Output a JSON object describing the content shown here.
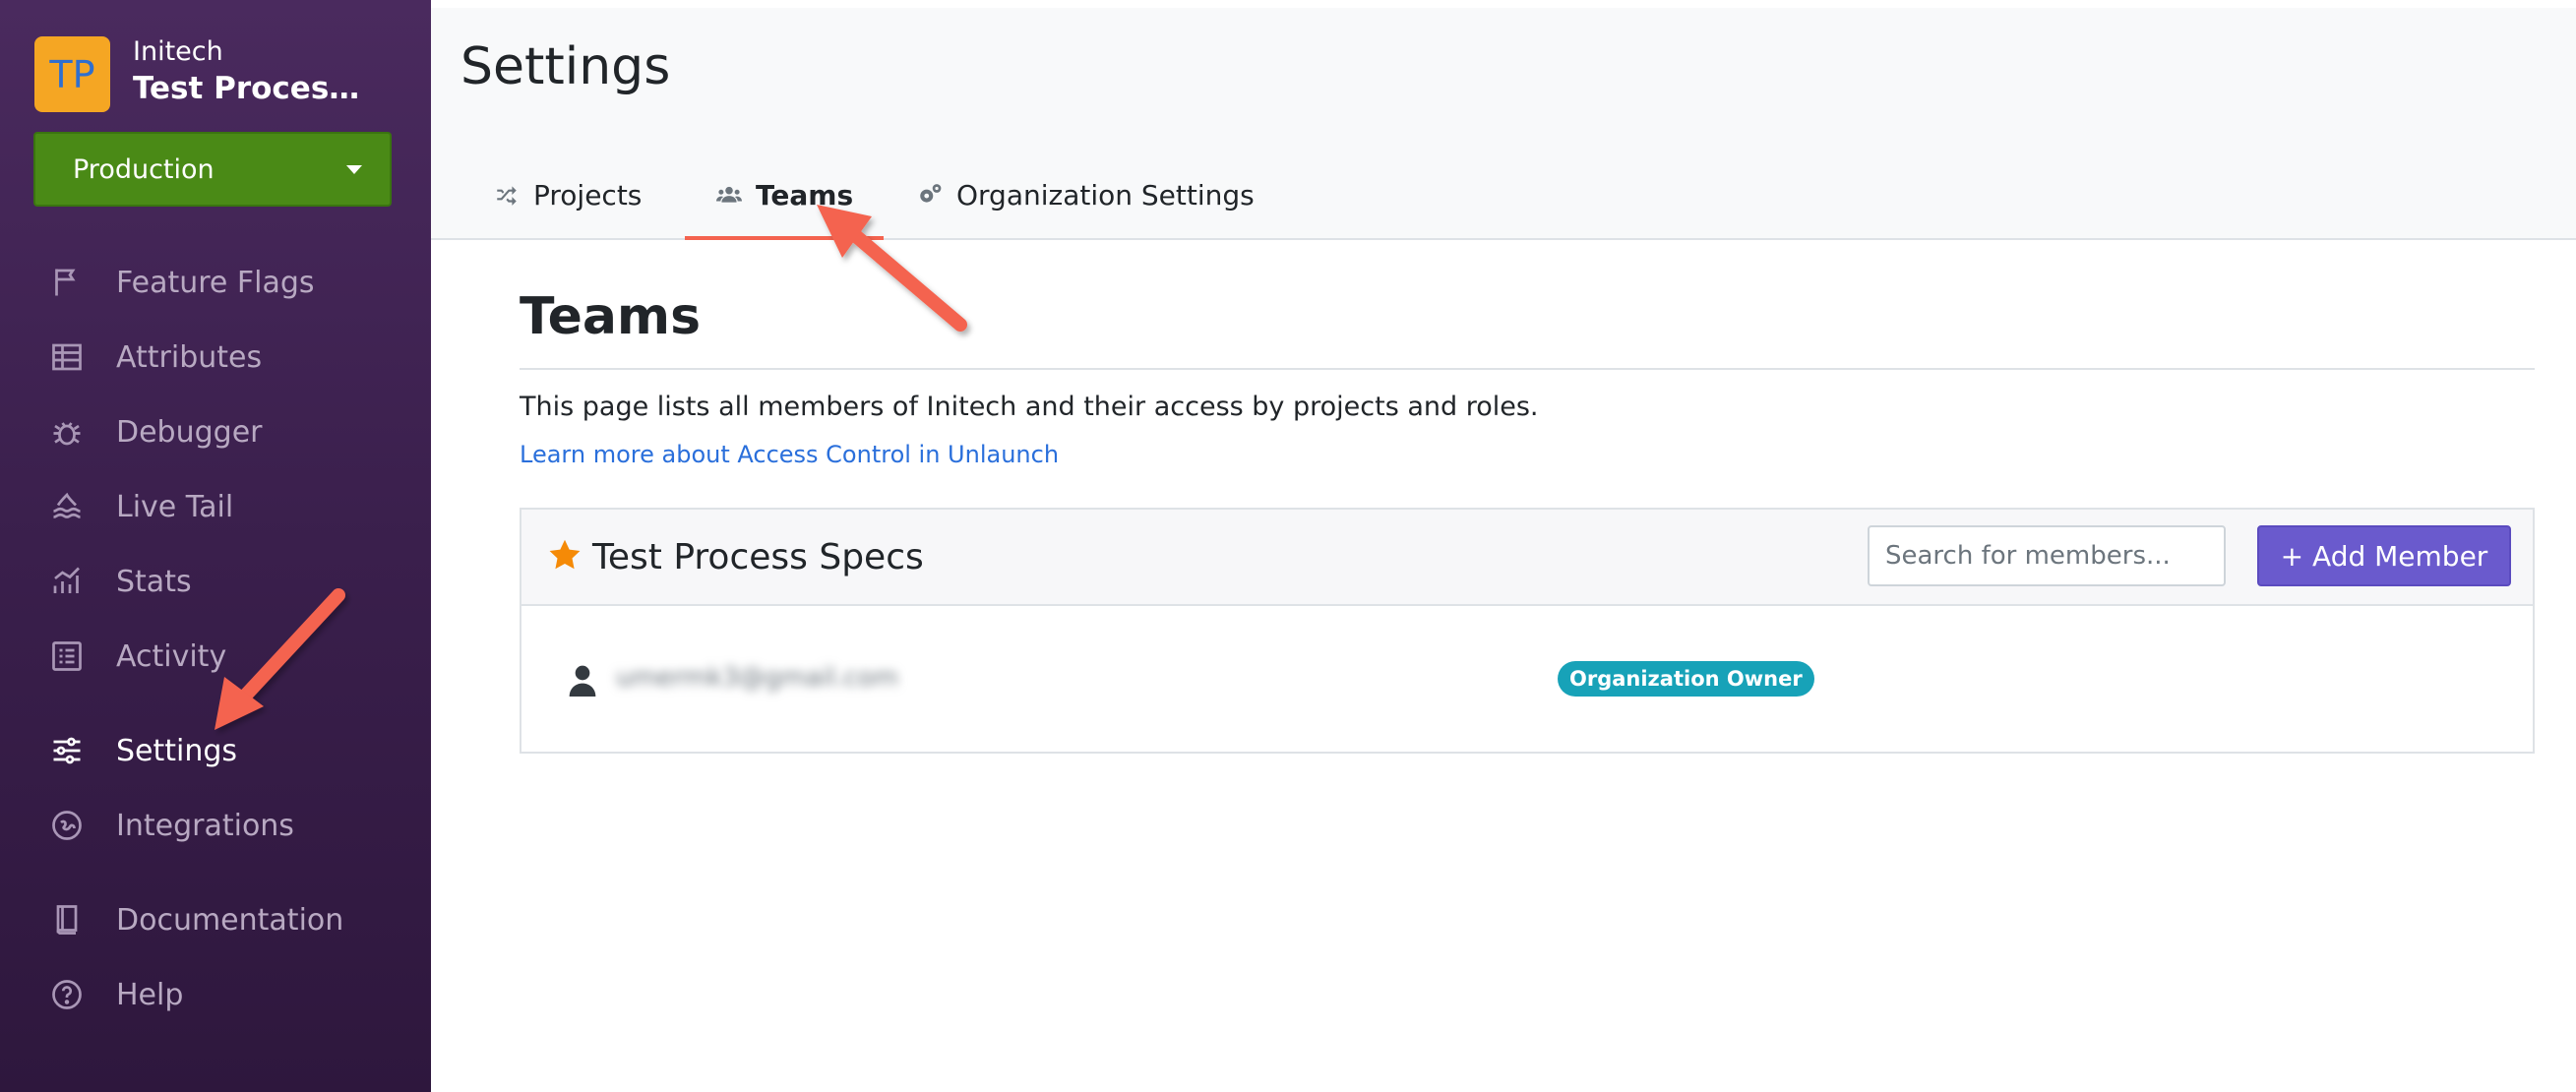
{
  "sidebar": {
    "org_initials": "TP",
    "org_name": "Initech",
    "project_name": "Test Process Specs",
    "environment": "Production",
    "items": [
      {
        "label": "Feature Flags",
        "icon": "flag-icon"
      },
      {
        "label": "Attributes",
        "icon": "attributes-icon"
      },
      {
        "label": "Debugger",
        "icon": "bug-icon"
      },
      {
        "label": "Live Tail",
        "icon": "water-icon"
      },
      {
        "label": "Stats",
        "icon": "chart-icon"
      },
      {
        "label": "Activity",
        "icon": "list-icon"
      },
      {
        "label": "Settings",
        "icon": "sliders-icon"
      },
      {
        "label": "Integrations",
        "icon": "puzzle-icon"
      },
      {
        "label": "Documentation",
        "icon": "book-icon"
      },
      {
        "label": "Help",
        "icon": "help-icon"
      }
    ]
  },
  "header": {
    "title": "Settings",
    "tabs": [
      {
        "label": "Projects",
        "icon": "shuffle-icon"
      },
      {
        "label": "Teams",
        "icon": "users-icon"
      },
      {
        "label": "Organization Settings",
        "icon": "cogs-icon"
      }
    ]
  },
  "main": {
    "title": "Teams",
    "description": "This page lists all members of Initech and their access by projects and roles.",
    "link_text": "Learn more about Access Control in Unlaunch",
    "team": {
      "name": "Test Process Specs",
      "search_placeholder": "Search for members...",
      "add_button": "+ Add Member",
      "members": [
        {
          "email": "umermk3@gmail.com",
          "role": "Organization Owner"
        }
      ]
    }
  },
  "colors": {
    "sidebar_bg": "#3a1f4c",
    "environment": "#4a8a16",
    "primary_button": "#6a5acd",
    "badge": "#17a2b8",
    "tab_underline": "#f4634f",
    "annotation_arrow": "#f4634f",
    "star": "#f58a07"
  }
}
